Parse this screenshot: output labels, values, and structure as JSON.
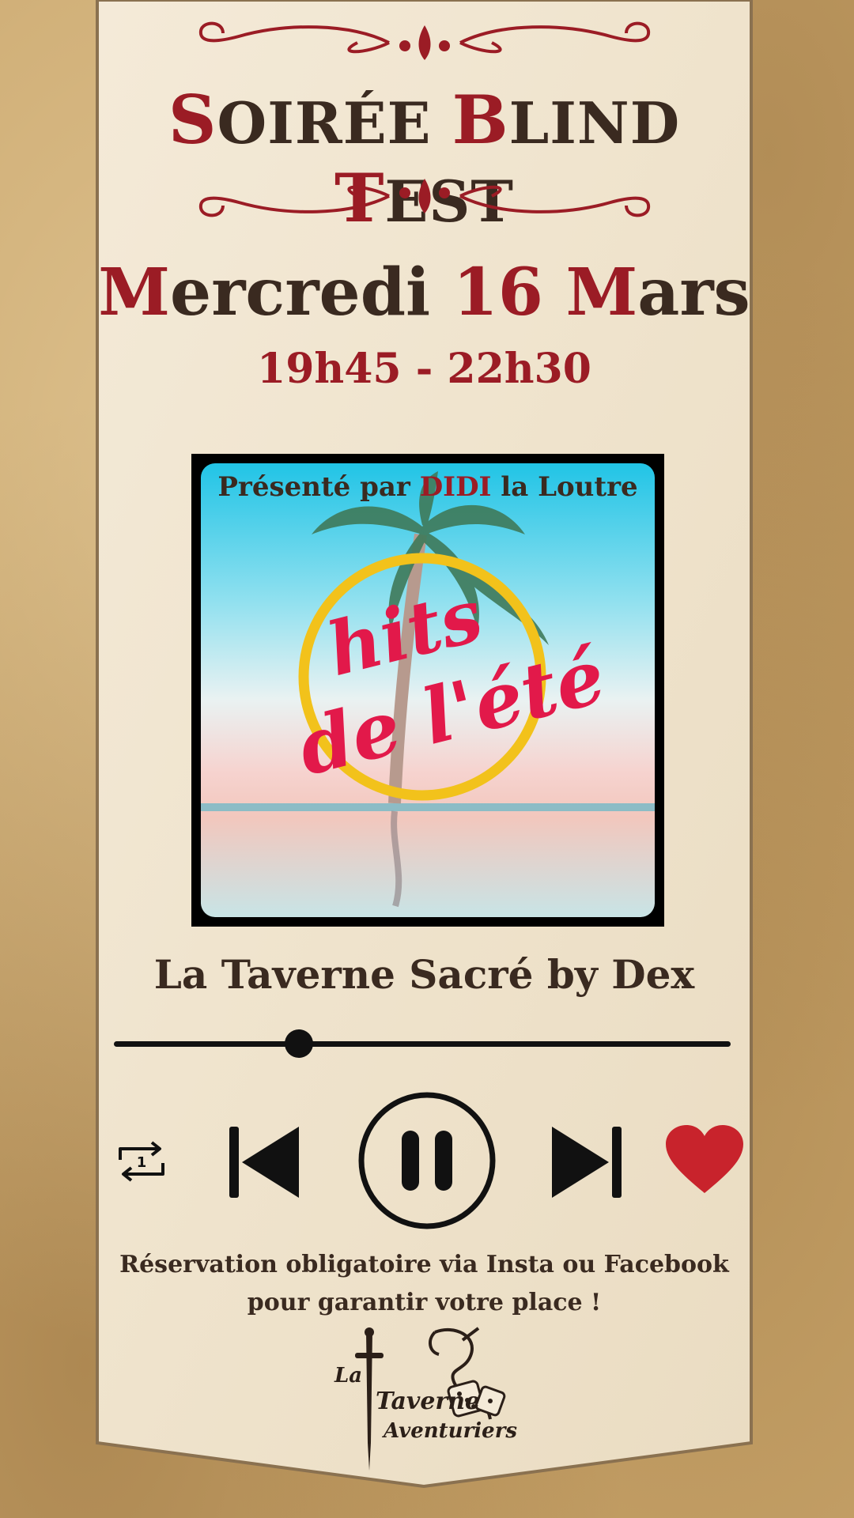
{
  "poster": {
    "title": {
      "words": [
        {
          "cap": "S",
          "rest": "OIRÉE "
        },
        {
          "cap": "B",
          "rest": "LIND "
        },
        {
          "cap": "T",
          "rest": "EST"
        }
      ]
    },
    "date": {
      "day_cap": "M",
      "day_rest": "ercredi ",
      "num": "16",
      "month_cap": " M",
      "month_rest": "ars"
    },
    "hours": "19h45 - 22h30",
    "presented_prefix": "Présenté par ",
    "presented_name": "DIDI",
    "presented_suffix": " la Loutre",
    "cover_line1": "hits",
    "cover_line2": "de l'été",
    "venue": "La Taverne Sacré by Dex",
    "player": {
      "progress": 0.3
    },
    "footer_line1": "Réservation obligatoire via Insta ou Facebook",
    "footer_line2": "pour garantir votre place !",
    "logo": {
      "line1": "La",
      "line2": "Taverne",
      "line3": "Aventuriers"
    }
  },
  "icons": [
    "repeat-one-icon",
    "skip-previous-icon",
    "pause-icon",
    "skip-next-icon",
    "heart-icon",
    "dagger-icon",
    "dragon-icon",
    "dice-icon"
  ],
  "colors": {
    "accent_red": "#9b1c25",
    "text_dark": "#3a2a20",
    "heart": "#c8232c",
    "parchment": "#f1e6d2"
  }
}
